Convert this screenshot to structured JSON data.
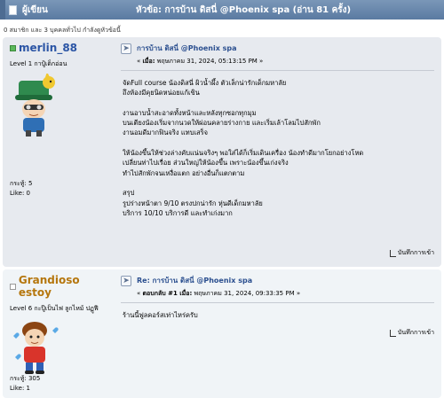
{
  "header": {
    "author_label": "ผู้เขียน",
    "topic_label": "หัวข้อ: การบ้าน ดิสนี่ @Phoenix spa  (อ่าน 81 ครั้ง)"
  },
  "info_line": "0 สมาชิก และ 3 บุคคลทั่วไป กำลังดูหัวข้อนี้",
  "posts": [
    {
      "username": "merlin_88",
      "online": true,
      "rank": "Level 1 กาปู้เด็กอ่อน",
      "posts_label": "กระทู้: 5",
      "like_label": "Like: 0",
      "title": "การบ้าน ดิสนี่ @Phoenix spa",
      "meta_prefix": "« ",
      "meta_on": "เมื่อ:",
      "meta_date": " พฤษภาคม 31, 2024, 05:13:15 PM »",
      "body": [
        "จัดFull course น้องดิสนี่ ผิวน้ำผึ้ง ตัวเล็กน่ารักเด็กมหาลัย",
        "ถึงห้องมีคุยนิดหน่อยแก้เขิน",
        "",
        "งานอาบน้ำสะอาดทั้งหน้าและหลังทุกซอกทุกมุม",
        "บนเตียงน้องเริ่มจากนวดให้ผ่อนคลายร่างกาย และเริ่มเล้าโลมไปสักพัก",
        "งานอมดีมากฟินจริง แทบเสร็จ",
        "",
        "ให้น้องขึ้นให้ช่วงล่างคับแน่นจริงๆ พอใส่ได้ก็เริ่มเดินเครื่อง น้องทำดีมากโยกอย่างโหด",
        "เปลี่ยนท่าไปเรื่อย ส่วนใหญ่ให้น้องขึ้น เพราะน้องขึ้นเก่งจริง",
        "ทำไปสักพักจนเหงื่อแตก อย่างอื่นก็แตกตาม",
        "",
        "สรุป",
        "รูปร่างหน้าตา 9/10 ตรงปกน่ารัก หุ่นดีเด็กมหาลัย",
        "บริการ 10/10 บริการดี และทำเก่งมาก"
      ],
      "report_label": "บันทึกการเข้า"
    },
    {
      "username": "Grandioso estoy",
      "online": false,
      "rank": "Level 6 กะปู๊เป็นไฟ ลูกไหม้ ปฏูฟี",
      "posts_label": "กระทู้: 305",
      "like_label": "Like: 1",
      "title": "Re: การบ้าน ดิสนี่ @Phoenix spa",
      "meta_prefix": "« ",
      "meta_on": "ตอบกลับ #1 เมื่อ:",
      "meta_date": " พฤษภาคม 31, 2024, 09:33:35 PM »",
      "body": [
        "ร้านนี้ฟูลคอร์สเท่าไหร่ครับ"
      ],
      "report_label": "บันทึกการเข้า"
    }
  ],
  "icons": {
    "topic": "document-icon",
    "post": "post-icon",
    "report": "report-icon"
  }
}
